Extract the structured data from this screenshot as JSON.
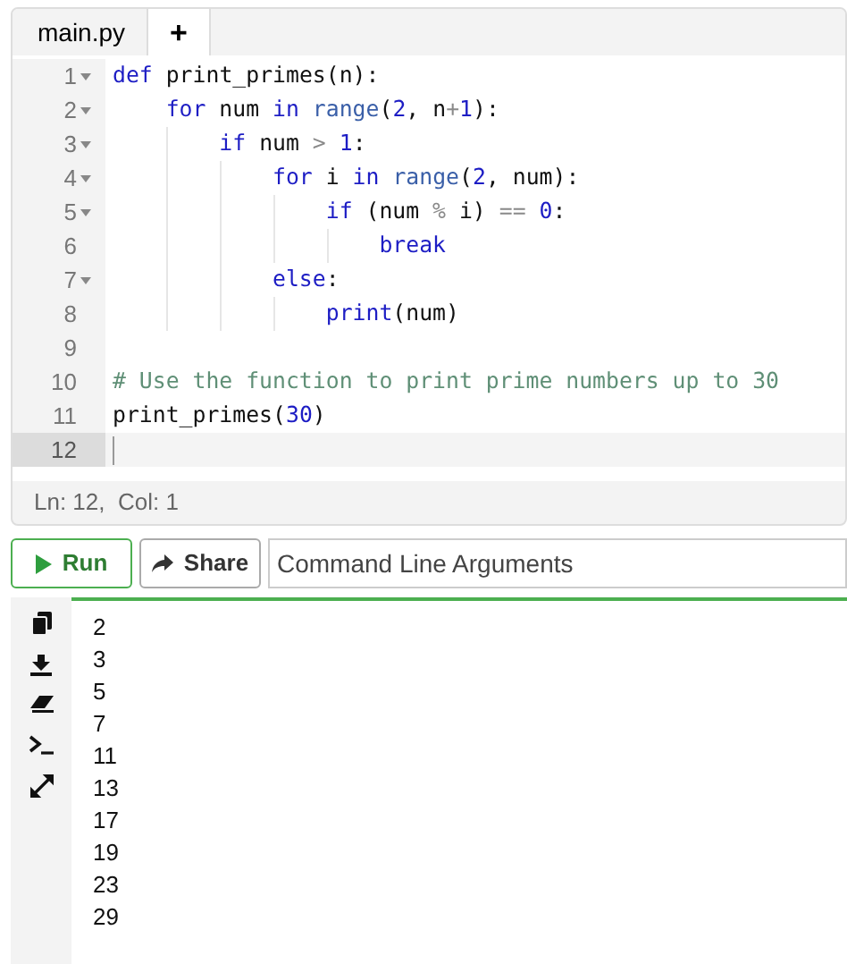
{
  "tabs": [
    {
      "label": "main.py",
      "kind": "file",
      "selected": true
    },
    {
      "label": "+",
      "kind": "add",
      "selected": false
    }
  ],
  "editor": {
    "lines": [
      {
        "number": "1",
        "foldable": true,
        "active": false,
        "tokens": [
          {
            "text": "def",
            "kind": "keyword"
          },
          {
            "text": " print_primes(n):",
            "kind": "plain"
          }
        ]
      },
      {
        "number": "2",
        "foldable": true,
        "active": false,
        "tokens": [
          {
            "text": "    for",
            "kind": "keyword"
          },
          {
            "text": " num ",
            "kind": "plain"
          },
          {
            "text": "in ",
            "kind": "keyword"
          },
          {
            "text": "range",
            "kind": "builtin"
          },
          {
            "text": "(",
            "kind": "plain"
          },
          {
            "text": "2",
            "kind": "number"
          },
          {
            "text": ", n",
            "kind": "plain"
          },
          {
            "text": "+",
            "kind": "operator"
          },
          {
            "text": "1",
            "kind": "number"
          },
          {
            "text": "):",
            "kind": "plain"
          }
        ]
      },
      {
        "number": "3",
        "foldable": true,
        "active": false,
        "tokens": [
          {
            "text": "        if",
            "kind": "keyword"
          },
          {
            "text": " num ",
            "kind": "plain"
          },
          {
            "text": "> ",
            "kind": "operator"
          },
          {
            "text": "1",
            "kind": "number"
          },
          {
            "text": ":",
            "kind": "plain"
          }
        ]
      },
      {
        "number": "4",
        "foldable": true,
        "active": false,
        "tokens": [
          {
            "text": "            for",
            "kind": "keyword"
          },
          {
            "text": " i ",
            "kind": "plain"
          },
          {
            "text": "in ",
            "kind": "keyword"
          },
          {
            "text": "range",
            "kind": "builtin"
          },
          {
            "text": "(",
            "kind": "plain"
          },
          {
            "text": "2",
            "kind": "number"
          },
          {
            "text": ", num):",
            "kind": "plain"
          }
        ]
      },
      {
        "number": "5",
        "foldable": true,
        "active": false,
        "tokens": [
          {
            "text": "                if",
            "kind": "keyword"
          },
          {
            "text": " (num ",
            "kind": "plain"
          },
          {
            "text": "%",
            "kind": "operator"
          },
          {
            "text": " i) ",
            "kind": "plain"
          },
          {
            "text": "== ",
            "kind": "operator"
          },
          {
            "text": "0",
            "kind": "number"
          },
          {
            "text": ":",
            "kind": "plain"
          }
        ]
      },
      {
        "number": "6",
        "foldable": false,
        "active": false,
        "tokens": [
          {
            "text": "                    break",
            "kind": "keyword"
          }
        ]
      },
      {
        "number": "7",
        "foldable": true,
        "active": false,
        "tokens": [
          {
            "text": "            else",
            "kind": "keyword"
          },
          {
            "text": ":",
            "kind": "plain"
          }
        ]
      },
      {
        "number": "8",
        "foldable": false,
        "active": false,
        "tokens": [
          {
            "text": "                print",
            "kind": "keyword"
          },
          {
            "text": "(num)",
            "kind": "plain"
          }
        ]
      },
      {
        "number": "9",
        "foldable": false,
        "active": false
      },
      {
        "number": "10",
        "foldable": false,
        "active": false,
        "tokens": [
          {
            "text": "# Use the function to print prime numbers up to 30",
            "kind": "comment"
          }
        ]
      },
      {
        "number": "11",
        "foldable": false,
        "active": false,
        "tokens": [
          {
            "text": "print_primes(",
            "kind": "plain"
          },
          {
            "text": "30",
            "kind": "number"
          },
          {
            "text": ")",
            "kind": "plain"
          }
        ]
      },
      {
        "number": "12",
        "foldable": false,
        "active": true
      }
    ]
  },
  "status_bar": {
    "position": "Ln: 12,  Col: 1"
  },
  "toolbar": {
    "run": "Run",
    "share": "Share",
    "arguments": {
      "placeholder": "Command Line Arguments"
    }
  },
  "output": {
    "lines": [
      "2",
      "3",
      "5",
      "7",
      "11",
      "13",
      "17",
      "19",
      "23",
      "29"
    ]
  }
}
